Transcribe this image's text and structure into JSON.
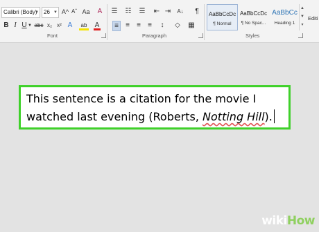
{
  "ribbon": {
    "font_name": "Calibri (Body)",
    "font_size": "26",
    "grow_font": "A^",
    "shrink_font": "Aˇ",
    "change_case": "Aa",
    "clear_formatting": "A",
    "bold": "B",
    "italic": "I",
    "underline": "U",
    "strikethrough": "abc",
    "subscript": "x₂",
    "superscript": "x²",
    "text_effects": "A",
    "highlight": "ab",
    "font_color": "A",
    "bullets": "☰",
    "numbering": "☷",
    "multilevel": "☰",
    "decrease_indent": "⇤",
    "increase_indent": "⇥",
    "sort": "A↓",
    "show_marks": "¶",
    "align_left": "≡",
    "center": "≡",
    "align_right": "≡",
    "justify": "≡",
    "line_spacing": "↕",
    "shading": "◇",
    "borders": "▦",
    "group_font": "Font",
    "group_paragraph": "Paragraph",
    "group_styles": "Styles",
    "editing": "Editi",
    "styles": [
      {
        "preview": "AaBbCcDc",
        "name": "¶ Normal",
        "selected": true
      },
      {
        "preview": "AaBbCcDc",
        "name": "¶ No Spac...",
        "selected": false
      },
      {
        "preview": "AaBbCc",
        "name": "Heading 1",
        "selected": false
      }
    ]
  },
  "document": {
    "text_before": "This sentence is a citation for the movie I watched last evening (Roberts, ",
    "title": "Notting Hill",
    "text_after": ")."
  },
  "watermark": {
    "wiki": "wiki",
    "how": "How"
  },
  "colors": {
    "highlight_border": "#3fd12a",
    "highlighter_yellow": "#f5e400",
    "font_color_red": "#e02020",
    "heading_blue": "#2e74b5"
  }
}
